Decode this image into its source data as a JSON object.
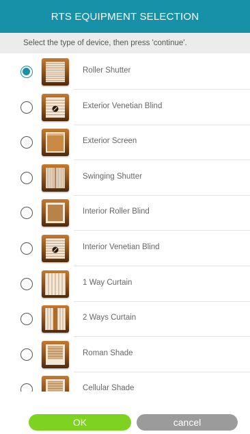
{
  "header": {
    "title": "RTS EQUIPMENT SELECTION"
  },
  "instruction": "Select the type of device, then press 'continue'.",
  "colors": {
    "header": "#1691a7",
    "ok": "#7ed321",
    "cancel": "#9b9b9b",
    "radio_selected": "#1691a7",
    "icon_bronze": "#8a4f18"
  },
  "devices": [
    {
      "label": "Roller Shutter",
      "icon": "roller-shutter-icon",
      "selected": true
    },
    {
      "label": "Exterior Venetian Blind",
      "icon": "exterior-venetian-blind-icon",
      "selected": false
    },
    {
      "label": "Exterior Screen",
      "icon": "exterior-screen-icon",
      "selected": false
    },
    {
      "label": "Swinging Shutter",
      "icon": "swinging-shutter-icon",
      "selected": false
    },
    {
      "label": "Interior Roller Blind",
      "icon": "interior-roller-blind-icon",
      "selected": false
    },
    {
      "label": "Interior Venetian Blind",
      "icon": "interior-venetian-blind-icon",
      "selected": false
    },
    {
      "label": "1 Way Curtain",
      "icon": "one-way-curtain-icon",
      "selected": false
    },
    {
      "label": "2 Ways Curtain",
      "icon": "two-ways-curtain-icon",
      "selected": false
    },
    {
      "label": "Roman Shade",
      "icon": "roman-shade-icon",
      "selected": false
    },
    {
      "label": "Cellular Shade",
      "icon": "cellular-shade-icon",
      "selected": false
    }
  ],
  "buttons": {
    "ok": "OK",
    "cancel": "cancel"
  }
}
